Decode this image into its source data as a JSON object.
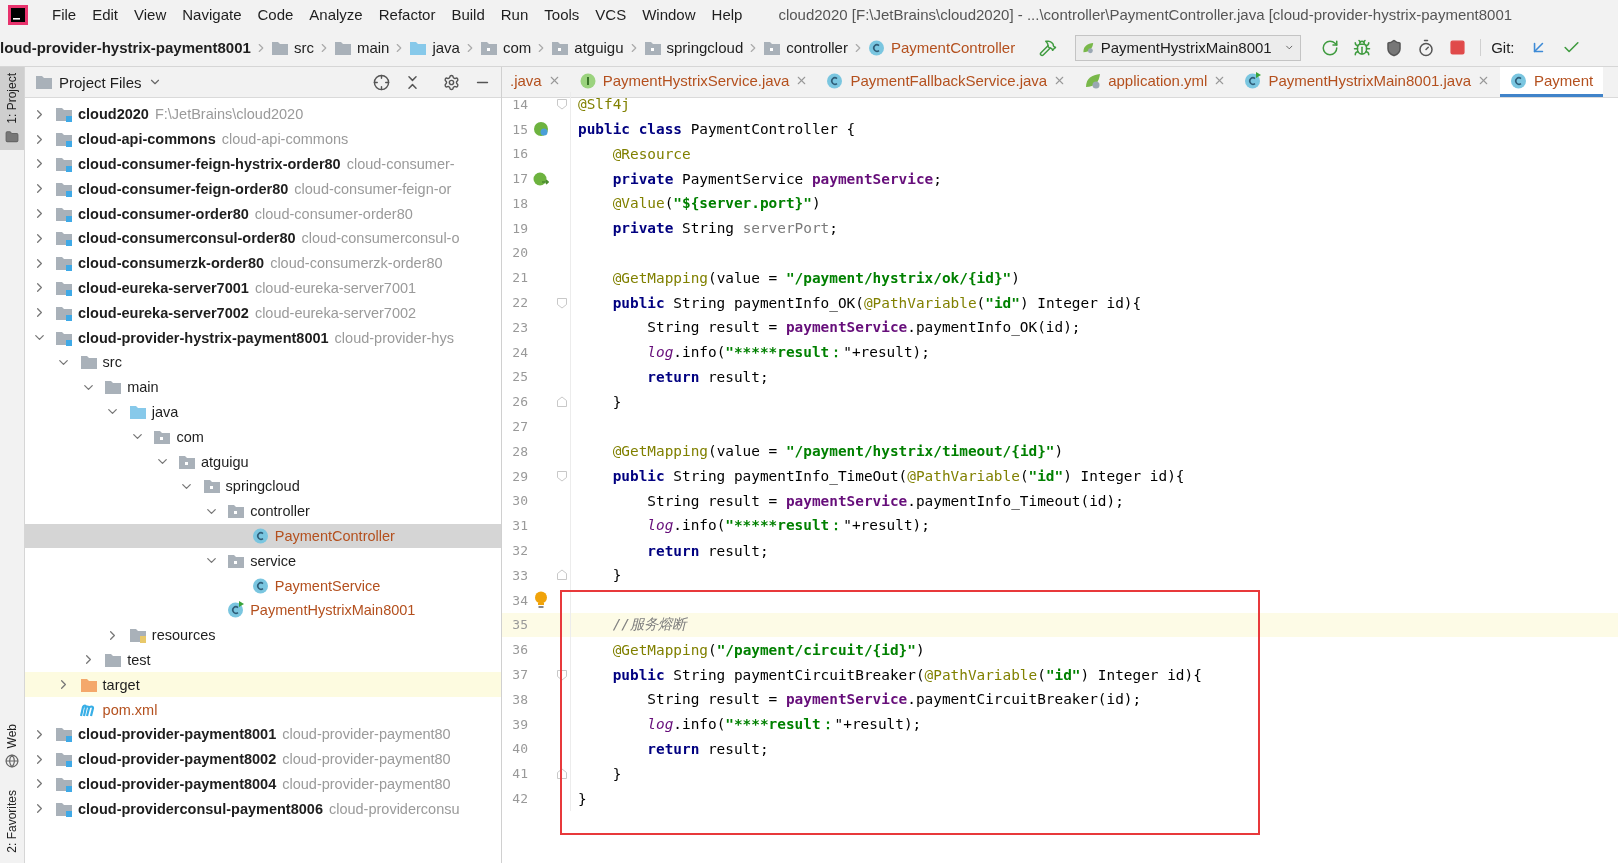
{
  "menu": [
    "File",
    "Edit",
    "View",
    "Navigate",
    "Code",
    "Analyze",
    "Refactor",
    "Build",
    "Run",
    "Tools",
    "VCS",
    "Window",
    "Help"
  ],
  "window": {
    "title": "cloud2020 [F:\\JetBrains\\cloud2020] - ...\\controller\\PaymentController.java [cloud-provider-hystrix-payment8001"
  },
  "breadcrumbs": [
    {
      "label": "loud-provider-hystrix-payment8001",
      "kind": "module"
    },
    {
      "label": "src",
      "kind": "folder"
    },
    {
      "label": "main",
      "kind": "folder"
    },
    {
      "label": "java",
      "kind": "source"
    },
    {
      "label": "com",
      "kind": "package"
    },
    {
      "label": "atguigu",
      "kind": "package"
    },
    {
      "label": "springcloud",
      "kind": "package"
    },
    {
      "label": "controller",
      "kind": "package"
    },
    {
      "label": "PaymentController",
      "kind": "class"
    }
  ],
  "run_config": {
    "value": "PaymentHystrixMain8001"
  },
  "git": {
    "label": "Git:"
  },
  "side_tabs": [
    {
      "label": "1: Project",
      "selected": true
    },
    {
      "label": "Web",
      "selected": false
    },
    {
      "label": "2: Favorites",
      "selected": false
    }
  ],
  "project": {
    "title": "Project Files",
    "tree": [
      {
        "label": "cloud2020",
        "description": "F:\\JetBrains\\cloud2020",
        "kind": "module",
        "expanded": false,
        "selected": false
      },
      {
        "label": "cloud-api-commons",
        "description": "cloud-api-commons",
        "kind": "module",
        "expanded": false,
        "selected": false
      },
      {
        "label": "cloud-consumer-feign-hystrix-order80",
        "description": "cloud-consumer-",
        "kind": "module",
        "expanded": false,
        "selected": false
      },
      {
        "label": "cloud-consumer-feign-order80",
        "description": "cloud-consumer-feign-or",
        "kind": "module",
        "expanded": false,
        "selected": false
      },
      {
        "label": "cloud-consumer-order80",
        "description": "cloud-consumer-order80",
        "kind": "module",
        "expanded": false,
        "selected": false
      },
      {
        "label": "cloud-consumerconsul-order80",
        "description": "cloud-consumerconsul-o",
        "kind": "module",
        "expanded": false,
        "selected": false
      },
      {
        "label": "cloud-consumerzk-order80",
        "description": "cloud-consumerzk-order80",
        "kind": "module",
        "expanded": false,
        "selected": false
      },
      {
        "label": "cloud-eureka-server7001",
        "description": "cloud-eureka-server7001",
        "kind": "module",
        "expanded": false,
        "selected": false
      },
      {
        "label": "cloud-eureka-server7002",
        "description": "cloud-eureka-server7002",
        "kind": "module",
        "expanded": false,
        "selected": false
      },
      {
        "label": "cloud-provider-hystrix-payment8001",
        "description": "cloud-provider-hys",
        "kind": "module",
        "expanded": true,
        "selected": false,
        "children": [
          {
            "label": "src",
            "kind": "folder",
            "expanded": true,
            "selected": false,
            "children": [
              {
                "label": "main",
                "kind": "folder",
                "expanded": true,
                "selected": false,
                "children": [
                  {
                    "label": "java",
                    "kind": "source",
                    "expanded": true,
                    "selected": false,
                    "children": [
                      {
                        "label": "com",
                        "kind": "package",
                        "expanded": true,
                        "selected": false,
                        "children": [
                          {
                            "label": "atguigu",
                            "kind": "package",
                            "expanded": true,
                            "selected": false,
                            "children": [
                              {
                                "label": "springcloud",
                                "kind": "package",
                                "expanded": true,
                                "selected": false,
                                "children": [
                                  {
                                    "label": "controller",
                                    "kind": "package",
                                    "expanded": true,
                                    "selected": false,
                                    "children": [
                                      {
                                        "label": "PaymentController",
                                        "kind": "class",
                                        "selected": true
                                      }
                                    ]
                                  },
                                  {
                                    "label": "service",
                                    "kind": "package",
                                    "expanded": true,
                                    "selected": false,
                                    "children": [
                                      {
                                        "label": "PaymentService",
                                        "kind": "class",
                                        "selected": false
                                      }
                                    ]
                                  },
                                  {
                                    "label": "PaymentHystrixMain8001",
                                    "kind": "main-class",
                                    "selected": false
                                  }
                                ]
                              }
                            ]
                          }
                        ]
                      }
                    ]
                  },
                  {
                    "label": "resources",
                    "kind": "resources",
                    "expanded": false,
                    "selected": false
                  }
                ]
              },
              {
                "label": "test",
                "kind": "folder",
                "expanded": false,
                "selected": false
              }
            ]
          },
          {
            "label": "target",
            "kind": "excluded",
            "expanded": false,
            "selected": false
          },
          {
            "label": "pom.xml",
            "kind": "maven",
            "selected": false
          }
        ]
      },
      {
        "label": "cloud-provider-payment8001",
        "description": "cloud-provider-payment80",
        "kind": "module",
        "expanded": false,
        "selected": false
      },
      {
        "label": "cloud-provider-payment8002",
        "description": "cloud-provider-payment80",
        "kind": "module",
        "expanded": false,
        "selected": false
      },
      {
        "label": "cloud-provider-payment8004",
        "description": "cloud-provider-payment80",
        "kind": "module",
        "expanded": false,
        "selected": false
      },
      {
        "label": "cloud-providerconsul-payment8006",
        "description": "cloud-providerconsu",
        "kind": "module",
        "expanded": false,
        "selected": false
      }
    ]
  },
  "tabs": [
    {
      "label": ".java",
      "kind": "plain",
      "selected": false
    },
    {
      "label": "PaymentHystrixService.java",
      "kind": "interface",
      "selected": false
    },
    {
      "label": "PaymentFallbackService.java",
      "kind": "class",
      "selected": false
    },
    {
      "label": "application.yml",
      "kind": "yaml",
      "selected": false
    },
    {
      "label": "PaymentHystrixMain8001.java",
      "kind": "main-class",
      "selected": false
    },
    {
      "label": "Payment",
      "kind": "class",
      "selected": true
    }
  ],
  "code": {
    "lines": [
      {
        "number": "14",
        "fold": {
          "kind": "start"
        },
        "boxed": false,
        "tokens": [
          {
            "kind": "ann",
            "text": "@Slf4j"
          }
        ]
      },
      {
        "number": "15",
        "gutter": {
          "kind": "bean"
        },
        "boxed": false,
        "tokens": [
          {
            "kind": "kw",
            "text": "public class"
          },
          {
            "kind": "plain",
            "text": " PaymentController {"
          }
        ]
      },
      {
        "number": "16",
        "boxed": false,
        "tokens": [
          {
            "kind": "ann",
            "text": "    @Resource"
          }
        ]
      },
      {
        "number": "17",
        "gutter": {
          "kind": "autowire"
        },
        "boxed": false,
        "tokens": [
          {
            "kind": "kw",
            "text": "    private"
          },
          {
            "kind": "plain",
            "text": " PaymentService "
          },
          {
            "kind": "field",
            "text": "paymentService"
          },
          {
            "kind": "plain",
            "text": ";"
          }
        ]
      },
      {
        "number": "18",
        "boxed": false,
        "tokens": [
          {
            "kind": "ann",
            "text": "    @Value"
          },
          {
            "kind": "plain",
            "text": "("
          },
          {
            "kind": "str",
            "text": "\"${server.port}\""
          },
          {
            "kind": "plain",
            "text": ")"
          }
        ]
      },
      {
        "number": "19",
        "boxed": false,
        "tokens": [
          {
            "kind": "kw",
            "text": "    private"
          },
          {
            "kind": "plain",
            "text": " String "
          },
          {
            "kind": "muted",
            "text": "serverPort"
          },
          {
            "kind": "plain",
            "text": ";"
          }
        ]
      },
      {
        "number": "20",
        "boxed": false
      },
      {
        "number": "21",
        "boxed": false,
        "tokens": [
          {
            "kind": "ann",
            "text": "    @GetMapping"
          },
          {
            "kind": "plain",
            "text": "(value = "
          },
          {
            "kind": "str",
            "text": "\"/payment/hystrix/ok/{id}\""
          },
          {
            "kind": "plain",
            "text": ")"
          }
        ]
      },
      {
        "number": "22",
        "fold": {
          "kind": "start"
        },
        "boxed": false,
        "tokens": [
          {
            "kind": "kw",
            "text": "    public"
          },
          {
            "kind": "plain",
            "text": " String paymentInfo_OK("
          },
          {
            "kind": "ann",
            "text": "@PathVariable"
          },
          {
            "kind": "plain",
            "text": "("
          },
          {
            "kind": "str",
            "text": "\"id\""
          },
          {
            "kind": "plain",
            "text": ") Integer id){"
          }
        ]
      },
      {
        "number": "23",
        "boxed": false,
        "tokens": [
          {
            "kind": "plain",
            "text": "        String result = "
          },
          {
            "kind": "field",
            "text": "paymentService"
          },
          {
            "kind": "plain",
            "text": ".paymentInfo_OK(id);"
          }
        ]
      },
      {
        "number": "24",
        "boxed": false,
        "tokens": [
          {
            "kind": "static",
            "text": "        log"
          },
          {
            "kind": "plain",
            "text": ".info("
          },
          {
            "kind": "str",
            "text": "\"*****result："
          },
          {
            "kind": "plain",
            "text": "\"+result);"
          }
        ]
      },
      {
        "number": "25",
        "boxed": false,
        "tokens": [
          {
            "kind": "kw",
            "text": "        return"
          },
          {
            "kind": "plain",
            "text": " result;"
          }
        ]
      },
      {
        "number": "26",
        "fold": {
          "kind": "end"
        },
        "boxed": false,
        "tokens": [
          {
            "kind": "plain",
            "text": "    }"
          }
        ]
      },
      {
        "number": "27",
        "boxed": false
      },
      {
        "number": "28",
        "boxed": false,
        "tokens": [
          {
            "kind": "ann",
            "text": "    @GetMapping"
          },
          {
            "kind": "plain",
            "text": "(value = "
          },
          {
            "kind": "str",
            "text": "\"/payment/hystrix/timeout/{id}\""
          },
          {
            "kind": "plain",
            "text": ")"
          }
        ]
      },
      {
        "number": "29",
        "fold": {
          "kind": "start"
        },
        "boxed": false,
        "tokens": [
          {
            "kind": "kw",
            "text": "    public"
          },
          {
            "kind": "plain",
            "text": " String paymentInfo_TimeOut("
          },
          {
            "kind": "ann",
            "text": "@PathVariable"
          },
          {
            "kind": "plain",
            "text": "("
          },
          {
            "kind": "str",
            "text": "\"id\""
          },
          {
            "kind": "plain",
            "text": ") Integer id){"
          }
        ]
      },
      {
        "number": "30",
        "boxed": false,
        "tokens": [
          {
            "kind": "plain",
            "text": "        String result = "
          },
          {
            "kind": "field",
            "text": "paymentService"
          },
          {
            "kind": "plain",
            "text": ".paymentInfo_Timeout(id);"
          }
        ]
      },
      {
        "number": "31",
        "boxed": false,
        "tokens": [
          {
            "kind": "static",
            "text": "        log"
          },
          {
            "kind": "plain",
            "text": ".info("
          },
          {
            "kind": "str",
            "text": "\"*****result："
          },
          {
            "kind": "plain",
            "text": "\"+result);"
          }
        ]
      },
      {
        "number": "32",
        "boxed": false,
        "tokens": [
          {
            "kind": "kw",
            "text": "        return"
          },
          {
            "kind": "plain",
            "text": " result;"
          }
        ]
      },
      {
        "number": "33",
        "fold": {
          "kind": "end"
        },
        "boxed": false,
        "tokens": [
          {
            "kind": "plain",
            "text": "    }"
          }
        ]
      },
      {
        "number": "34",
        "gutter": {
          "kind": "bulb"
        },
        "boxed": true
      },
      {
        "number": "35",
        "current": true,
        "boxed": true,
        "tokens": [
          {
            "kind": "comment",
            "text": "    //服务熔断"
          }
        ]
      },
      {
        "number": "36",
        "boxed": true,
        "tokens": [
          {
            "kind": "ann",
            "text": "    @GetMapping"
          },
          {
            "kind": "plain",
            "text": "("
          },
          {
            "kind": "str",
            "text": "\"/payment/circuit/{id}\""
          },
          {
            "kind": "plain",
            "text": ")"
          }
        ]
      },
      {
        "number": "37",
        "fold": {
          "kind": "start"
        },
        "boxed": true,
        "tokens": [
          {
            "kind": "kw",
            "text": "    public"
          },
          {
            "kind": "plain",
            "text": " String paymentCircuitBreaker("
          },
          {
            "kind": "ann",
            "text": "@PathVariable"
          },
          {
            "kind": "plain",
            "text": "("
          },
          {
            "kind": "str",
            "text": "\"id\""
          },
          {
            "kind": "plain",
            "text": ") Integer id){"
          }
        ]
      },
      {
        "number": "38",
        "boxed": true,
        "tokens": [
          {
            "kind": "plain",
            "text": "        String result = "
          },
          {
            "kind": "field",
            "text": "paymentService"
          },
          {
            "kind": "plain",
            "text": ".paymentCircuitBreaker(id);"
          }
        ]
      },
      {
        "number": "39",
        "boxed": true,
        "tokens": [
          {
            "kind": "static",
            "text": "        log"
          },
          {
            "kind": "plain",
            "text": ".info("
          },
          {
            "kind": "str",
            "text": "\"****result："
          },
          {
            "kind": "plain",
            "text": "\"+result);"
          }
        ]
      },
      {
        "number": "40",
        "boxed": true,
        "tokens": [
          {
            "kind": "kw",
            "text": "        return"
          },
          {
            "kind": "plain",
            "text": " result;"
          }
        ]
      },
      {
        "number": "41",
        "fold": {
          "kind": "end"
        },
        "boxed": true,
        "tokens": [
          {
            "kind": "plain",
            "text": "    }"
          }
        ]
      },
      {
        "number": "42",
        "boxed": true,
        "tokens": [
          {
            "kind": "plain",
            "text": "}"
          }
        ]
      }
    ]
  }
}
